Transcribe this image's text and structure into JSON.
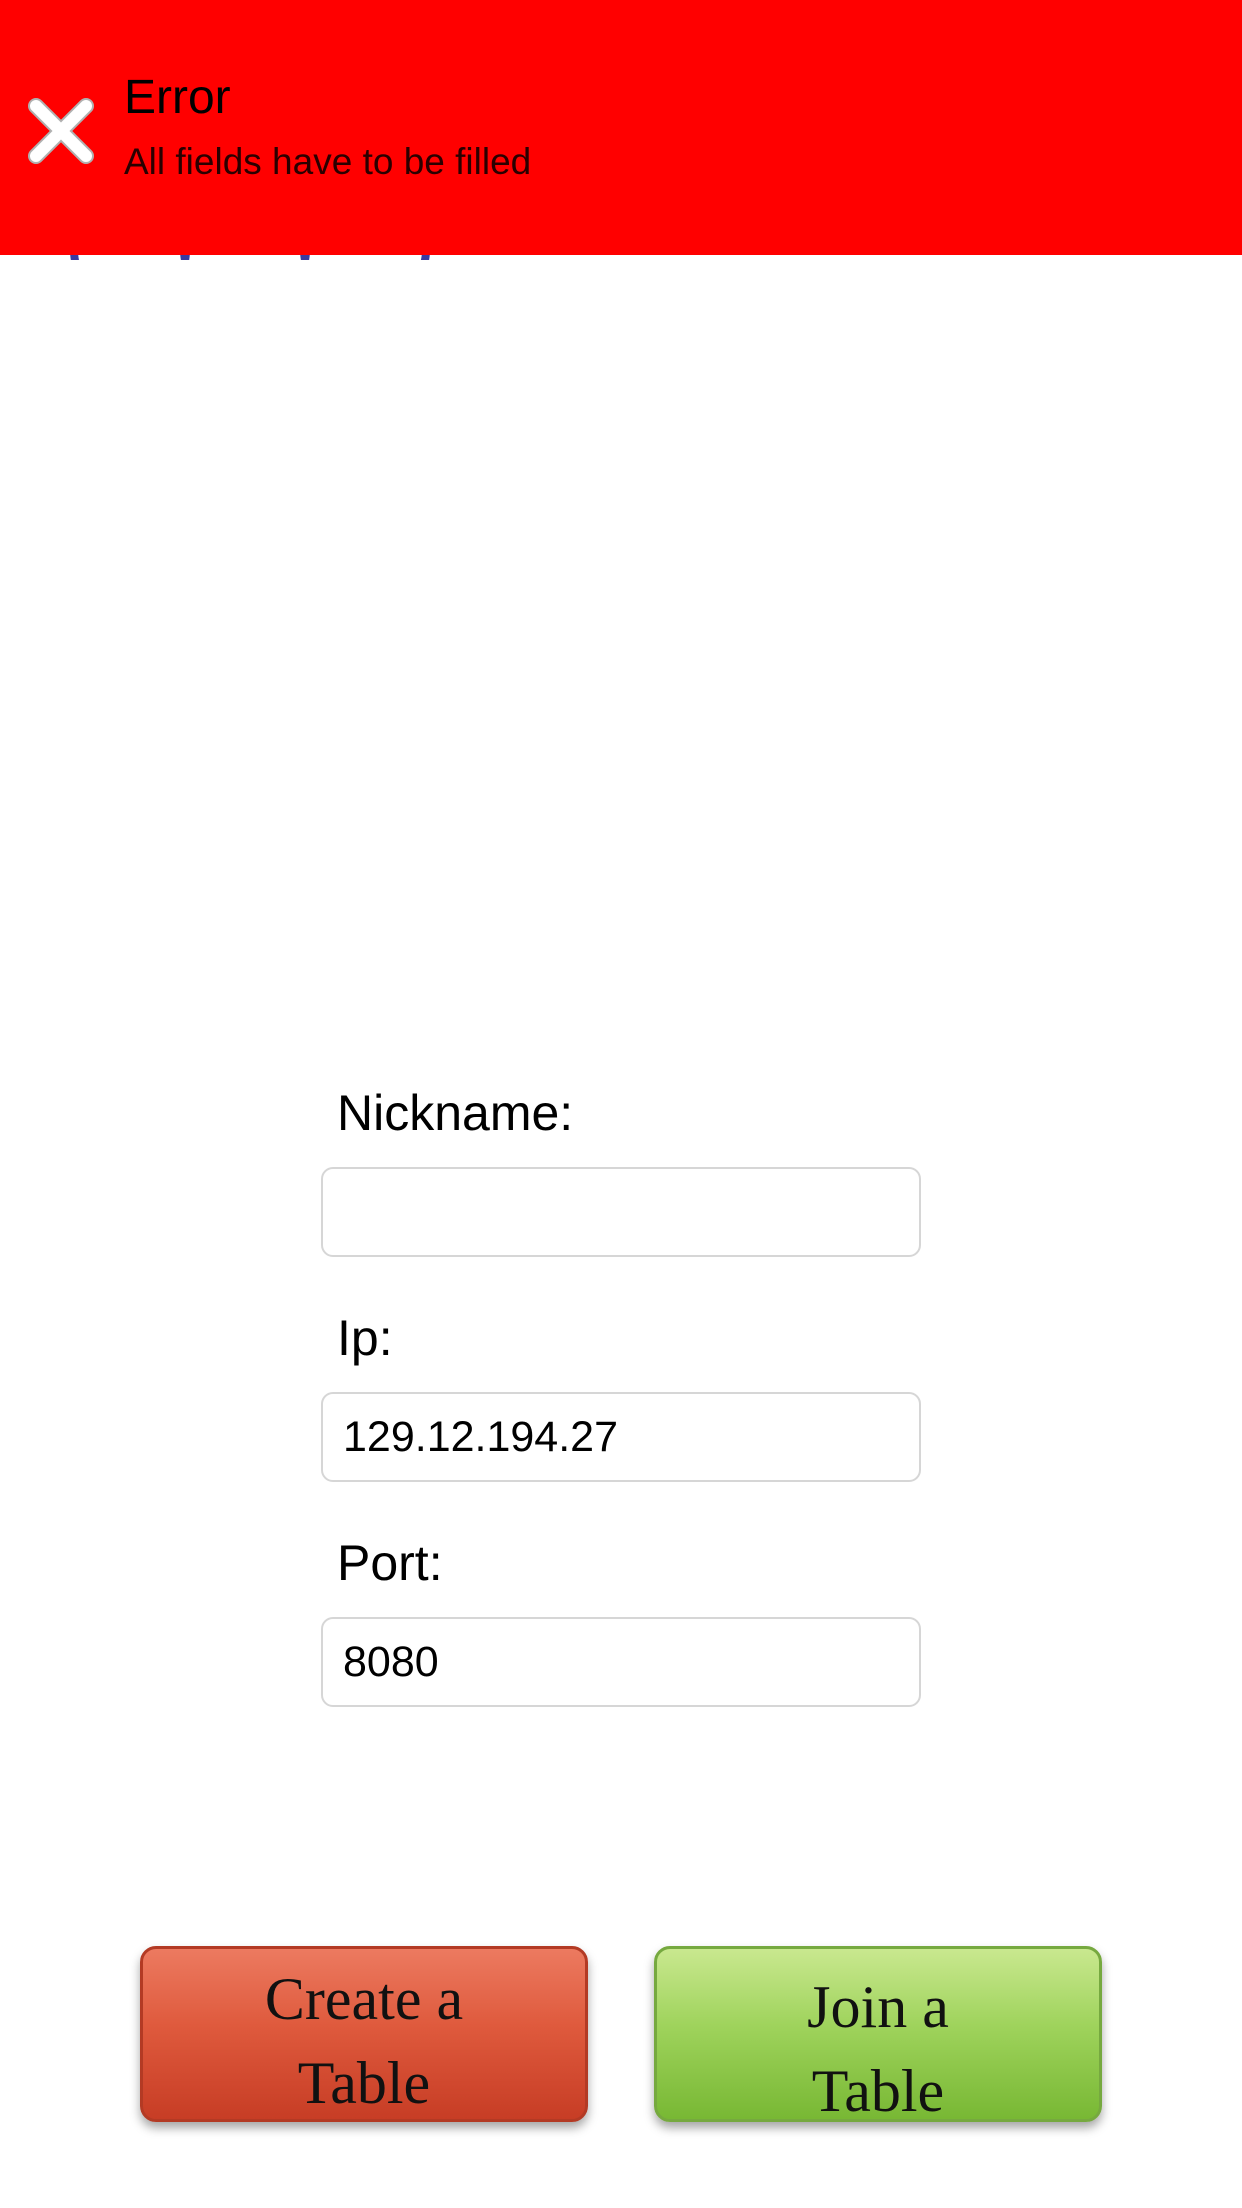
{
  "banner": {
    "title": "Error",
    "message": "All fields have to be filled",
    "background_color": "#ff0000",
    "icon": "close-x-icon"
  },
  "form": {
    "nickname": {
      "label": "Nickname:",
      "value": ""
    },
    "ip": {
      "label": "Ip:",
      "value": "129.12.194.27"
    },
    "port": {
      "label": "Port:",
      "value": "8080"
    }
  },
  "buttons": {
    "create": {
      "line1": "Create a",
      "line2": "Table",
      "color": "#df5a3d"
    },
    "join": {
      "line1": "Join a",
      "line2": "Table",
      "color": "#9fd35c"
    }
  }
}
